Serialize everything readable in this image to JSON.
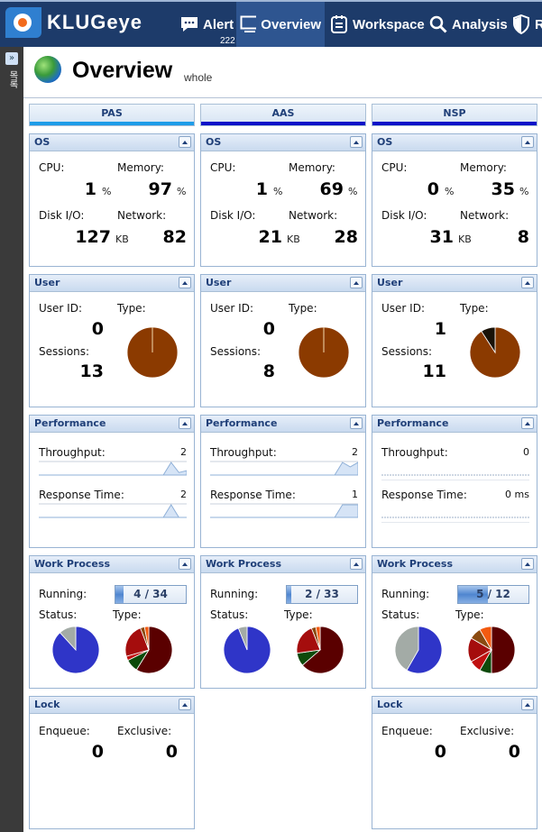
{
  "app": {
    "brand": "KLUGeye"
  },
  "nav": [
    {
      "label": "Alert",
      "icon": "chat-icon",
      "badge": "222"
    },
    {
      "label": "Overview",
      "icon": "monitor-icon",
      "active": true
    },
    {
      "label": "Workspace",
      "icon": "clipboard-icon"
    },
    {
      "label": "Analysis",
      "icon": "search-icon"
    },
    {
      "label": "R",
      "icon": "shield-icon"
    }
  ],
  "sidebar": {
    "label": "목록",
    "toggle": "»"
  },
  "page": {
    "title": "Overview",
    "subtitle": "whole"
  },
  "labels": {
    "os": "OS",
    "cpu": "CPU:",
    "memory": "Memory:",
    "disk": "Disk I/O:",
    "network": "Network:",
    "pct": "%",
    "kb": "KB",
    "user": "User",
    "user_id": "User ID:",
    "type": "Type:",
    "sessions": "Sessions:",
    "performance": "Performance",
    "throughput": "Throughput:",
    "response": "Response Time:",
    "work_process": "Work Process",
    "running": "Running:",
    "status": "Status:",
    "lock": "Lock",
    "enqueue": "Enqueue:",
    "exclusive": "Exclusive:"
  },
  "colors": {
    "pie_user": [
      "#8b3a00",
      "#1a1208"
    ],
    "pie_status": [
      "#2f35c8",
      "#a3aba6"
    ],
    "pie_type": [
      "#5a0000",
      "#0d4a0a",
      "#c01010",
      "#a50d0d",
      "#8b4a10",
      "#f25a10"
    ]
  },
  "columns": [
    {
      "name": "PAS",
      "accent": "#1e9ce8",
      "os": {
        "cpu": "1",
        "memory": "97",
        "disk": "127",
        "network": "82"
      },
      "user": {
        "user_id": "0",
        "sessions": "13",
        "type_pie": [
          13,
          0
        ]
      },
      "perf": {
        "throughput": "2",
        "response": "2",
        "throughput_series": [
          0,
          0,
          0,
          0,
          0,
          0,
          0,
          0,
          0,
          0,
          0,
          0,
          0,
          0,
          0,
          0,
          0,
          2,
          0.4,
          0.7
        ],
        "response_series": [
          0,
          0,
          0,
          0,
          0,
          0,
          0,
          0,
          0,
          0,
          0,
          0,
          0,
          0,
          0,
          0,
          0,
          2,
          0,
          0
        ]
      },
      "wp": {
        "running": 4,
        "total": 34,
        "running_text": "4 / 34",
        "status_pie": [
          30,
          4
        ],
        "type_pie": [
          20,
          3,
          1,
          8,
          1,
          1
        ]
      },
      "lock": {
        "enqueue": "0",
        "exclusive": "0"
      }
    },
    {
      "name": "AAS",
      "accent": "#0b12c8",
      "os": {
        "cpu": "1",
        "memory": "69",
        "disk": "21",
        "network": "28"
      },
      "user": {
        "user_id": "0",
        "sessions": "8",
        "type_pie": [
          8,
          0
        ]
      },
      "perf": {
        "throughput": "2",
        "response": "1",
        "throughput_series": [
          0,
          0,
          0,
          0,
          0,
          0,
          0,
          0,
          0,
          0,
          0,
          0,
          0,
          0,
          0,
          0,
          0,
          2,
          1.3,
          2
        ],
        "response_series": [
          0,
          0,
          0,
          0,
          0,
          0,
          0,
          0,
          0,
          0,
          0,
          0,
          0,
          0,
          0,
          0,
          0,
          1,
          1,
          1
        ]
      },
      "wp": {
        "running": 2,
        "total": 33,
        "running_text": "2 / 33",
        "status_pie": [
          31,
          2
        ],
        "type_pie": [
          21,
          3,
          0,
          7,
          1,
          1
        ]
      },
      "lock": null
    },
    {
      "name": "NSP",
      "accent": "#0b12c8",
      "os": {
        "cpu": "0",
        "memory": "35",
        "disk": "31",
        "network": "8"
      },
      "user": {
        "user_id": "1",
        "sessions": "11",
        "type_pie": [
          10,
          1
        ]
      },
      "perf": {
        "throughput": "0",
        "response": "0 ms",
        "throughput_series": [],
        "response_series": []
      },
      "wp": {
        "running": 5,
        "total": 12,
        "running_text": "5 / 12",
        "status_pie": [
          7,
          5
        ],
        "type_pie": [
          6,
          1,
          1,
          2,
          1,
          1
        ]
      },
      "lock": {
        "enqueue": "0",
        "exclusive": "0"
      }
    }
  ]
}
